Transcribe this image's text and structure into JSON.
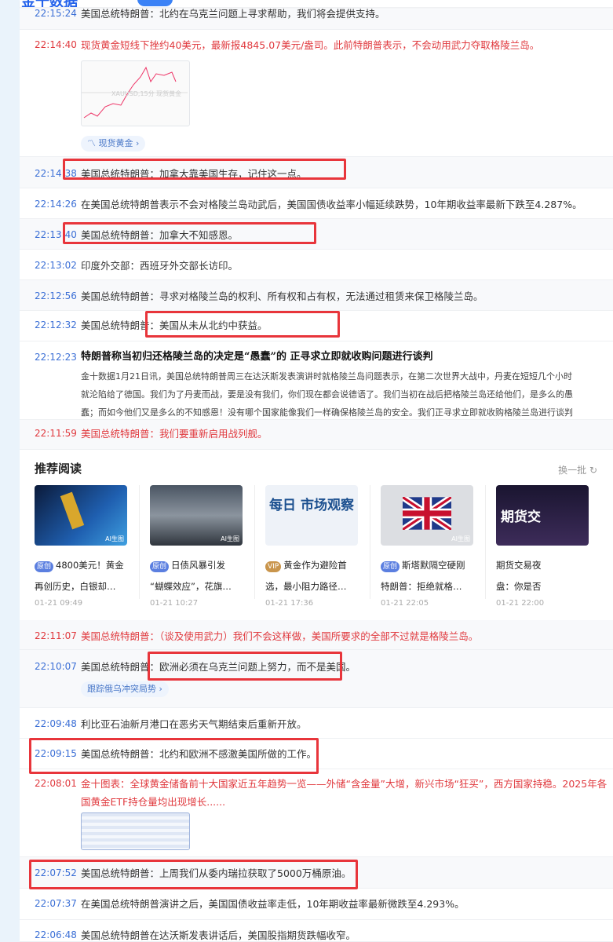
{
  "header": {
    "logo": "金十数据"
  },
  "feed_top": [
    {
      "time": "22:15:24",
      "text": "美国总统特朗普：北约在乌克兰问题上寻求帮助，我们将会提供支持。",
      "red": false
    },
    {
      "time": "22:14:40",
      "text": "现货黄金短线下挫约40美元，最新报4845.07美元/盎司。此前特朗普表示，不会动用武力夺取格陵兰岛。",
      "red": true,
      "tag": "现货黄金 ›",
      "chart_caption": "XAUUSD,15分 现货黄金"
    },
    {
      "time": "22:14:38",
      "text": "美国总统特朗普：加拿大靠美国生存，记住这一点。"
    },
    {
      "time": "22:14:26",
      "text": "在美国总统特朗普表示不会对格陵兰岛动武后，美国国债收益率小幅延续跌势，10年期收益率最新下跌至4.287%。"
    },
    {
      "time": "22:13:40",
      "text": "美国总统特朗普：加拿大不知感恩。"
    },
    {
      "time": "22:13:02",
      "text": "印度外交部：西班牙外交部长访印。"
    },
    {
      "time": "22:12:56",
      "text": "美国总统特朗普：寻求对格陵兰岛的权利、所有权和占有权，无法通过租赁来保卫格陵兰岛。"
    },
    {
      "time": "22:12:32",
      "text": "美国总统特朗普：美国从未从北约中获益。"
    },
    {
      "time": "22:12:23",
      "title": "特朗普称当初归还格陵兰岛的决定是“愚蠢”的 正寻求立即就收购问题进行谈判",
      "body": [
        "金十数据1月21日讯，美国总统特朗普周三在达沃斯发表演讲时就格陵兰岛问题表示，在第二次世界大战中，丹麦在短短几个小时",
        "就沦陷给了德国。我们为了丹麦而战，要是没有我们，你们现在都会说德语了。我们当初在战后把格陵兰岛还给他们，是多么的愚",
        "蠢；而如今他们又是多么的不知感恩！没有哪个国家能像我们一样确保格陵兰岛的安全。我们正寻求立即就收购格陵兰岛进行谈判"
      ]
    },
    {
      "time": "22:11:59",
      "text": "美国总统特朗普：我们要重新启用战列舰。",
      "red": true
    }
  ],
  "recommend": {
    "title": "推荐阅读",
    "swap": "换一批",
    "cards": [
      {
        "badge": "原创",
        "line1": "4800美元！黄金",
        "line2": "再创历史，白银却…",
        "date": "01-21 09:49",
        "ai": "AI生图"
      },
      {
        "badge": "原创",
        "line1": "日债风暴引发",
        "line2": "“蝴蝶效应”，花旗…",
        "date": "01-21 10:27",
        "ai": "AI生图"
      },
      {
        "badge": "VIP",
        "line1": "黄金作为避险首",
        "line2": "选，最小阻力路径…",
        "date": "01-21 17:36",
        "img_text": "每日 市场观察"
      },
      {
        "badge": "原创",
        "line1": "斯塔默隔空硬刚",
        "line2": "特朗普：拒绝就格…",
        "date": "01-21 22:05",
        "ai": "AI生图"
      },
      {
        "line1": "期货交易夜",
        "line2": "盘：你是否",
        "date": "01-21 22:00",
        "img_text": "期货交"
      }
    ]
  },
  "feed_bottom": [
    {
      "time": "22:11:07",
      "text": "美国总统特朗普：（谈及使用武力）我们不会这样做，美国所要求的全部不过就是格陵兰岛。",
      "red": true
    },
    {
      "time": "22:10:07",
      "text": "美国总统特朗普：欧洲必须在乌克兰问题上努力，而不是美国。",
      "tag": "跟踪俄乌冲突局势 ›"
    },
    {
      "time": "22:09:48",
      "text": "利比亚石油新月港口在恶劣天气期结束后重新开放。"
    },
    {
      "time": "22:09:15",
      "text": "美国总统特朗普：北约和欧洲不感激美国所做的工作。"
    },
    {
      "time": "22:08:01",
      "text": "金十图表：全球黄金储备前十大国家近五年趋势一览——外储“含金量”大增，新兴市场“狂买”，西方国家持稳。2025年各国黄金",
      "text2": "ETF持仓量均出现增长......",
      "red": true
    },
    {
      "time": "22:07:52",
      "text": "美国总统特朗普：上周我们从委内瑞拉获取了5000万桶原油。"
    },
    {
      "time": "22:07:37",
      "text": "在美国总统特朗普演讲之后，美国国债收益率走低，10年期收益率最新微跌至4.293%。"
    },
    {
      "time": "22:06:48",
      "text": "美国总统特朗普在达沃斯发表讲话后，美国股指期货跌幅收窄。"
    }
  ],
  "colors": {
    "accent": "#3b6fd6",
    "important": "#e0393e",
    "annotation": "#e8353b"
  }
}
